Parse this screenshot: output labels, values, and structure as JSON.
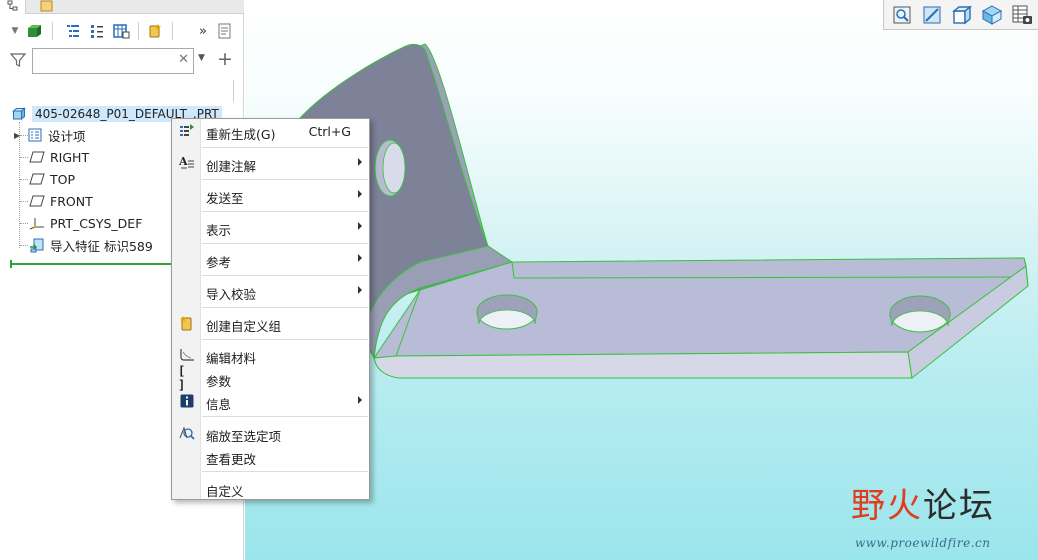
{
  "panel": {
    "tabs": [
      {
        "name": "model-tree-tab",
        "glyph": "⸬"
      },
      {
        "name": "folder-browser-tab",
        "glyph": "▭"
      }
    ],
    "search": {
      "value": "",
      "placeholder": ""
    }
  },
  "tree": {
    "root": {
      "label": "405-02648_P01_DEFAULT_.PRT"
    },
    "items": [
      {
        "label": "设计项",
        "icon": "design-items-icon",
        "expandable": true
      },
      {
        "label": "RIGHT",
        "icon": "datum-plane-icon",
        "expandable": false
      },
      {
        "label": "TOP",
        "icon": "datum-plane-icon",
        "expandable": false
      },
      {
        "label": "FRONT",
        "icon": "datum-plane-icon",
        "expandable": false
      },
      {
        "label": "PRT_CSYS_DEF",
        "icon": "coordinate-system-icon",
        "expandable": false
      },
      {
        "label": "导入特征 标识589",
        "icon": "import-feature-icon",
        "expandable": false
      }
    ]
  },
  "context_menu": {
    "items": [
      {
        "label": "重新生成(G)",
        "shortcut": "Ctrl+G",
        "icon": "regenerate-icon",
        "submenu": false
      },
      {
        "label": "创建注解",
        "icon": "annotation-icon",
        "submenu": true
      },
      {
        "label": "发送至",
        "icon": "",
        "submenu": true
      },
      {
        "label": "表示",
        "icon": "",
        "submenu": true
      },
      {
        "label": "参考",
        "icon": "",
        "submenu": true
      },
      {
        "label": "导入校验",
        "icon": "",
        "submenu": true
      },
      {
        "label": "创建自定义组",
        "icon": "group-icon",
        "submenu": false
      },
      {
        "label": "编辑材料",
        "icon": "material-icon",
        "submenu": false
      },
      {
        "label": "参数",
        "icon": "parameters-icon",
        "submenu": false
      },
      {
        "label": "信息",
        "icon": "info-icon",
        "submenu": true
      },
      {
        "label": "缩放至选定项",
        "icon": "zoom-to-selected-icon",
        "submenu": false
      },
      {
        "label": "查看更改",
        "icon": "",
        "submenu": false
      },
      {
        "label": "自定义",
        "icon": "",
        "submenu": false
      }
    ]
  },
  "view_toolbar": {
    "buttons": [
      "refit-icon",
      "zoom-in-icon",
      "saved-orientations-icon",
      "display-style-icon",
      "view-manager-icon"
    ]
  },
  "watermark": {
    "brand_part1": "野火",
    "brand_part2": "论坛",
    "url": "www.proewildfire.cn"
  },
  "colors": {
    "selection": "#cfe8fb",
    "model_face_dark": "#7d8299",
    "model_face_light": "#b9bcd6",
    "edge_highlight": "#37c23a",
    "viewport_bottom": "#9ae5ec"
  }
}
